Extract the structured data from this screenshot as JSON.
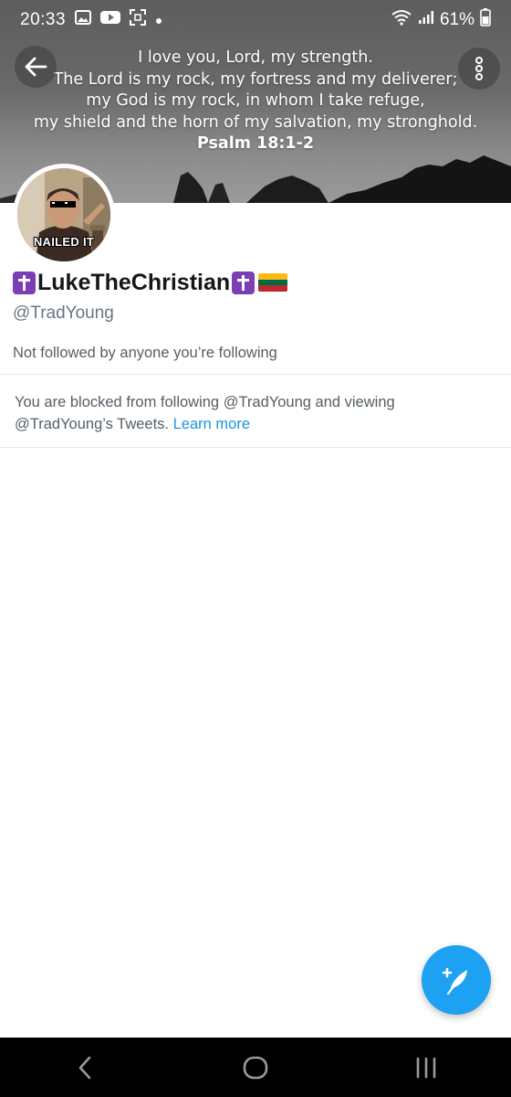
{
  "status_bar": {
    "time": "20:33",
    "battery": "61%",
    "icons": [
      "gallery-icon",
      "youtube-icon",
      "screenshot-icon",
      "dot-icon",
      "wifi-icon",
      "signal-icon"
    ]
  },
  "banner": {
    "verse_lines": [
      "I love you, Lord, my strength.",
      "The Lord is my rock, my fortress and my deliverer;",
      "my God is my rock, in whom I take refuge,",
      "my shield and the horn of my salvation, my stronghold."
    ],
    "verse_ref": "Psalm 18:1-2"
  },
  "profile": {
    "avatar_caption": "NAILED IT",
    "display_name": "LukeTheChristian",
    "handle": "@TradYoung",
    "followed_by": "Not followed by anyone you’re following"
  },
  "blocked": {
    "message": "You are blocked from following @TradYoung and viewing @TradYoung’s Tweets.",
    "learn_more": "Learn more"
  },
  "colors": {
    "accent": "#1da1f2",
    "link": "#1b95e0",
    "cross_emoji_bg": "#7b3fb5",
    "flag": [
      "#fdb913",
      "#006a44",
      "#c1272d"
    ]
  }
}
